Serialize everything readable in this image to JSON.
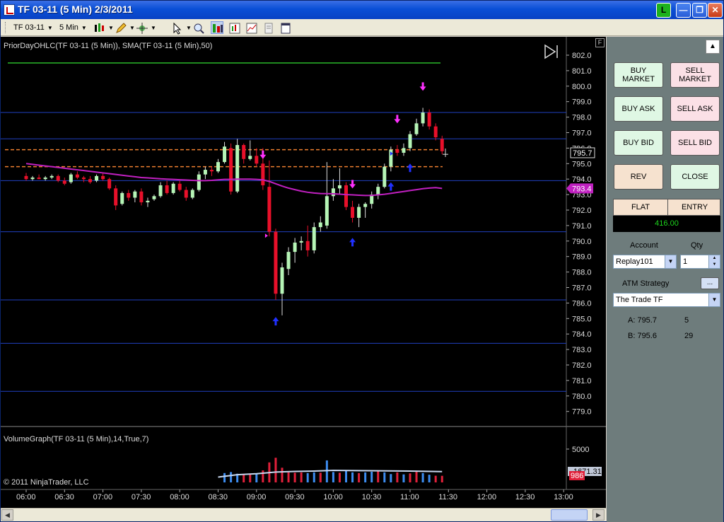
{
  "window": {
    "title": "TF 03-11 (5 Min)  2/3/2011",
    "btn_l": "L"
  },
  "toolbar": {
    "instrument": "TF 03-11",
    "interval": "5 Min"
  },
  "chart": {
    "indicator_label": "PriorDayOHLC(TF 03-11 (5 Min)), SMA(TF 03-11 (5 Min),50)",
    "volume_label": "VolumeGraph(TF 03-11 (5 Min),14,True,7)",
    "copyright": "© 2011 NinjaTrader, LLC",
    "f_button": "F",
    "price_ticks": [
      "802.0",
      "801.0",
      "800.0",
      "799.0",
      "798.0",
      "797.0",
      "796.0",
      "795.0",
      "794.0",
      "793.0",
      "792.0",
      "791.0",
      "790.0",
      "789.0",
      "788.0",
      "787.0",
      "786.0",
      "785.0",
      "784.0",
      "783.0",
      "782.0",
      "781.0",
      "780.0",
      "779.0"
    ],
    "volume_ticks": [
      "5000"
    ],
    "time_ticks": [
      "06:00",
      "06:30",
      "07:00",
      "07:30",
      "08:00",
      "08:30",
      "09:00",
      "09:30",
      "10:00",
      "10:30",
      "11:00",
      "11:30",
      "12:00",
      "12:30",
      "13:00"
    ],
    "last_price_label": "795.7",
    "sma_label": "793.4",
    "volume_avg_label": "1671.31",
    "volume_last_label": "986",
    "colors": {
      "up": "#b6f5b6",
      "down": "#e8102a",
      "sma": "#c020c0",
      "prior_high": "#1f8a1f",
      "prior_levels": "#f08030",
      "hlines": "#2040c0",
      "vol_up": "#3c8cf0",
      "vol_down": "#e0203a",
      "vol_avg": "#c8d8f0"
    }
  },
  "chart_data": {
    "type": "candlestick",
    "ylim": [
      778.5,
      802.5
    ],
    "price_levels_blue": [
      798.3,
      796.6,
      793.9,
      790.6,
      786.2,
      783.4,
      780.3
    ],
    "prior_day_high": 801.5,
    "prior_day_levels": [
      795.9,
      794.8
    ],
    "candles_approx": [
      {
        "t": "09:10",
        "o": 794.0,
        "h": 795.5,
        "l": 790.0,
        "c": 790.5
      },
      {
        "t": "09:15",
        "o": 790.5,
        "h": 791.0,
        "l": 785.5,
        "c": 786.0
      },
      {
        "t": "09:20",
        "o": 786.5,
        "h": 788.5,
        "l": 785.0,
        "c": 788.0
      },
      {
        "t": "10:05",
        "o": 793.0,
        "h": 793.5,
        "l": 791.0,
        "c": 791.5
      },
      {
        "t": "10:45",
        "o": 795.0,
        "h": 796.0,
        "l": 794.0,
        "c": 795.8
      },
      {
        "t": "11:05",
        "o": 798.3,
        "h": 798.6,
        "l": 797.3,
        "c": 797.5
      },
      {
        "t": "11:25",
        "o": 796.3,
        "h": 796.5,
        "l": 795.6,
        "c": 795.7
      }
    ],
    "volume_ylim": [
      0,
      6500
    ]
  },
  "panel": {
    "buy_market": "BUY\nMARKET",
    "sell_market": "SELL\nMARKET",
    "buy_ask": "BUY ASK",
    "sell_ask": "SELL ASK",
    "buy_bid": "BUY BID",
    "sell_bid": "SELL BID",
    "rev": "REV",
    "close": "CLOSE",
    "position": "FLAT",
    "entry": "ENTRY",
    "pnl": "416.00",
    "account_label": "Account",
    "qty_label": "Qty",
    "account_value": "Replay101",
    "qty_value": "1",
    "atm_label": "ATM Strategy",
    "atm_button": "...",
    "atm_value": "The Trade TF",
    "ask_price": "A: 795.7",
    "ask_size": "5",
    "bid_price": "B: 795.6",
    "bid_size": "29"
  }
}
